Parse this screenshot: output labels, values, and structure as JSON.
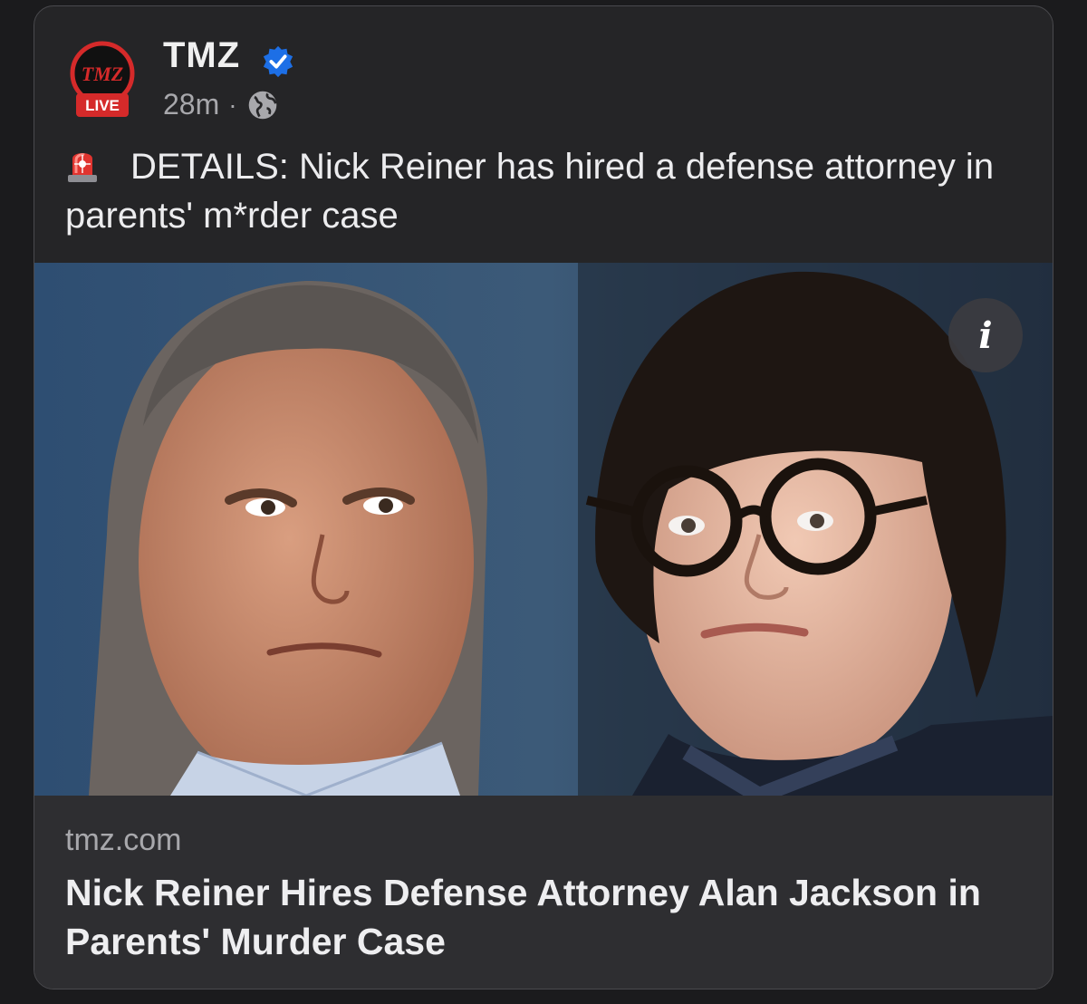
{
  "post": {
    "page_name": "TMZ",
    "avatar_logo_text": "TMZ",
    "avatar_badge": "LIVE",
    "verified_icon": "verified-check-icon",
    "timestamp": "28m",
    "separator": "·",
    "audience_icon": "globe-icon",
    "text_emoji_icon": "siren-icon",
    "text": "DETAILS: Nick Reiner has hired a defense attorney in parents' m*rder case"
  },
  "image": {
    "info_label": "i"
  },
  "link_preview": {
    "domain": "tmz.com",
    "headline": "Nick Reiner Hires Defense Attorney Alan Jackson in Parents' Murder Case"
  },
  "colors": {
    "background": "#1b1b1d",
    "card": "#252527",
    "link_preview": "#2e2e31",
    "verified_blue": "#1d6fe6",
    "tmz_red": "#d52a2a"
  }
}
